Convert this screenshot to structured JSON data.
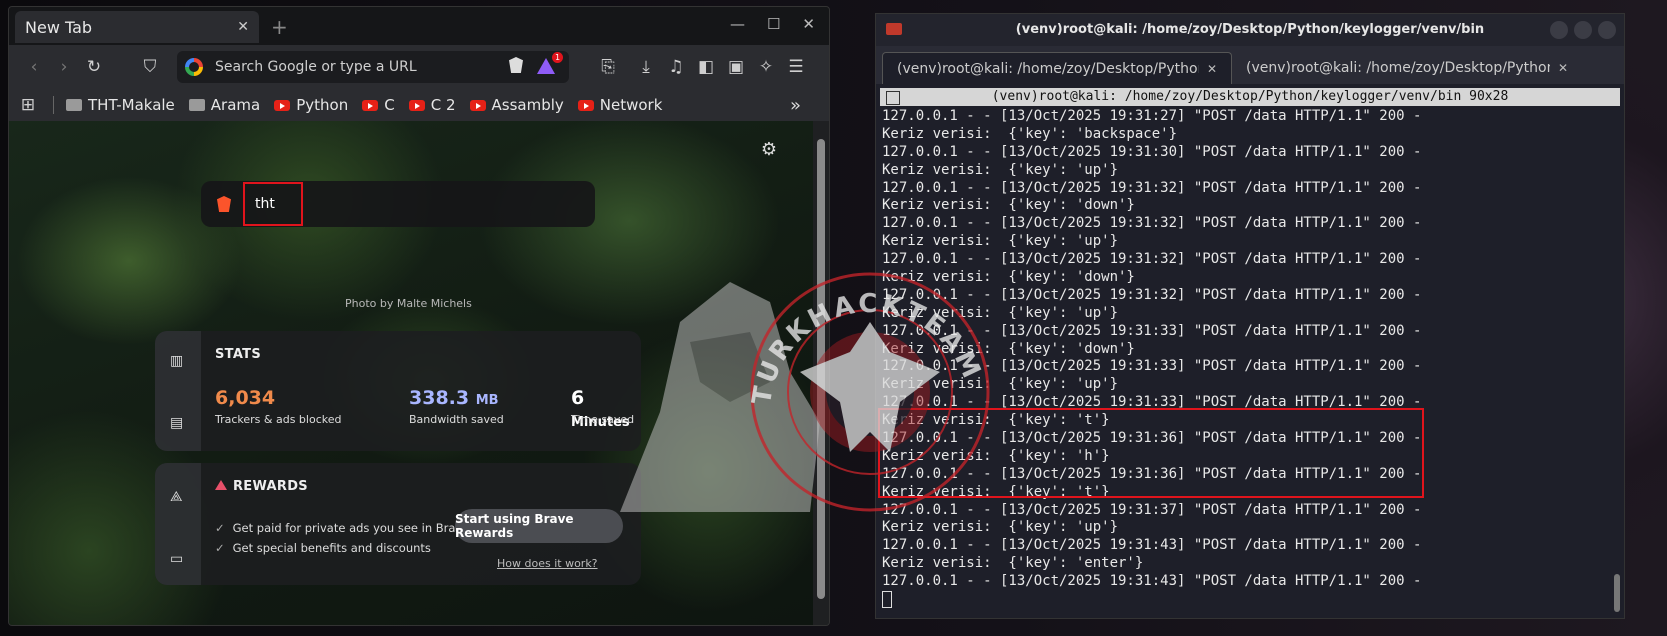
{
  "browser": {
    "tab_title": "New Tab",
    "tab_close": "✕",
    "new_tab": "+",
    "url_placeholder": "Search Google or type a URL",
    "rewards_badge": "1",
    "bookmarks": [
      {
        "label": "THT-Makale",
        "icon": "folder-icon"
      },
      {
        "label": "Arama",
        "icon": "folder-icon"
      },
      {
        "label": "Python",
        "icon": "youtube-icon"
      },
      {
        "label": "C",
        "icon": "youtube-icon"
      },
      {
        "label": "C 2",
        "icon": "youtube-icon"
      },
      {
        "label": "Assambly",
        "icon": "youtube-icon"
      },
      {
        "label": "Network",
        "icon": "youtube-icon"
      }
    ],
    "more_bookmarks": "»",
    "search_text": "tht",
    "photo_credit": "Photo by Malte Michels",
    "stats": {
      "title": "STATS",
      "trackers_value": "6,034",
      "trackers_label": "Trackers & ads blocked",
      "bandwidth_value": "338.3",
      "bandwidth_unit": "MB",
      "bandwidth_label": "Bandwidth saved",
      "time_value": "6",
      "time_unit": "Minutes",
      "time_label": "Time saved"
    },
    "rewards": {
      "title": "REWARDS",
      "bullet_1": "Get paid for private ads you see in Brave",
      "bullet_2": "Get special benefits and discounts",
      "button": "Start using Brave Rewards",
      "link": "How does it work?"
    },
    "colors": {
      "trackers": "#f08a4b",
      "bandwidth": "#a9b6ff",
      "time": "#ffffff",
      "highlight": "#e0141c"
    }
  },
  "terminal": {
    "title": "(venv)root@kali: /home/zoy/Desktop/Python/keylogger/venv/bin",
    "tabs": [
      {
        "label": "(venv)root@kali: /home/zoy/Desktop/Python/…",
        "close": "✕",
        "active": true
      },
      {
        "label": "(venv)root@kali: /home/zoy/Desktop/Python/…",
        "close": "✕",
        "active": false
      }
    ],
    "header": "(venv)root@kali: /home/zoy/Desktop/Python/keylogger/venv/bin 90x28",
    "lines": [
      "127.0.0.1 - - [13/Oct/2025 19:31:27] \"POST /data HTTP/1.1\" 200 -",
      "Keriz verisi:  {'key': 'backspace'}",
      "127.0.0.1 - - [13/Oct/2025 19:31:30] \"POST /data HTTP/1.1\" 200 -",
      "Keriz verisi:  {'key': 'up'}",
      "127.0.0.1 - - [13/Oct/2025 19:31:32] \"POST /data HTTP/1.1\" 200 -",
      "Keriz verisi:  {'key': 'down'}",
      "127.0.0.1 - - [13/Oct/2025 19:31:32] \"POST /data HTTP/1.1\" 200 -",
      "Keriz verisi:  {'key': 'up'}",
      "127.0.0.1 - - [13/Oct/2025 19:31:32] \"POST /data HTTP/1.1\" 200 -",
      "Keriz verisi:  {'key': 'down'}",
      "127.0.0.1 - - [13/Oct/2025 19:31:32] \"POST /data HTTP/1.1\" 200 -",
      "Keriz verisi:  {'key': 'up'}",
      "127.0.0.1 - - [13/Oct/2025 19:31:33] \"POST /data HTTP/1.1\" 200 -",
      "Keriz verisi:  {'key': 'down'}",
      "127.0.0.1 - - [13/Oct/2025 19:31:33] \"POST /data HTTP/1.1\" 200 -",
      "Keriz verisi:  {'key': 'up'}",
      "127.0.0.1 - - [13/Oct/2025 19:31:33] \"POST /data HTTP/1.1\" 200 -",
      "Keriz verisi:  {'key': 't'}",
      "127.0.0.1 - - [13/Oct/2025 19:31:36] \"POST /data HTTP/1.1\" 200 -",
      "Keriz verisi:  {'key': 'h'}",
      "127.0.0.1 - - [13/Oct/2025 19:31:36] \"POST /data HTTP/1.1\" 200 -",
      "Keriz verisi:  {'key': 't'}",
      "127.0.0.1 - - [13/Oct/2025 19:31:37] \"POST /data HTTP/1.1\" 200 -",
      "Keriz verisi:  {'key': 'up'}",
      "127.0.0.1 - - [13/Oct/2025 19:31:43] \"POST /data HTTP/1.1\" 200 -",
      "Keriz verisi:  {'key': 'enter'}",
      "127.0.0.1 - - [13/Oct/2025 19:31:43] \"POST /data HTTP/1.1\" 200 -"
    ]
  },
  "watermark": {
    "text": "TURKHACKTEAM"
  }
}
